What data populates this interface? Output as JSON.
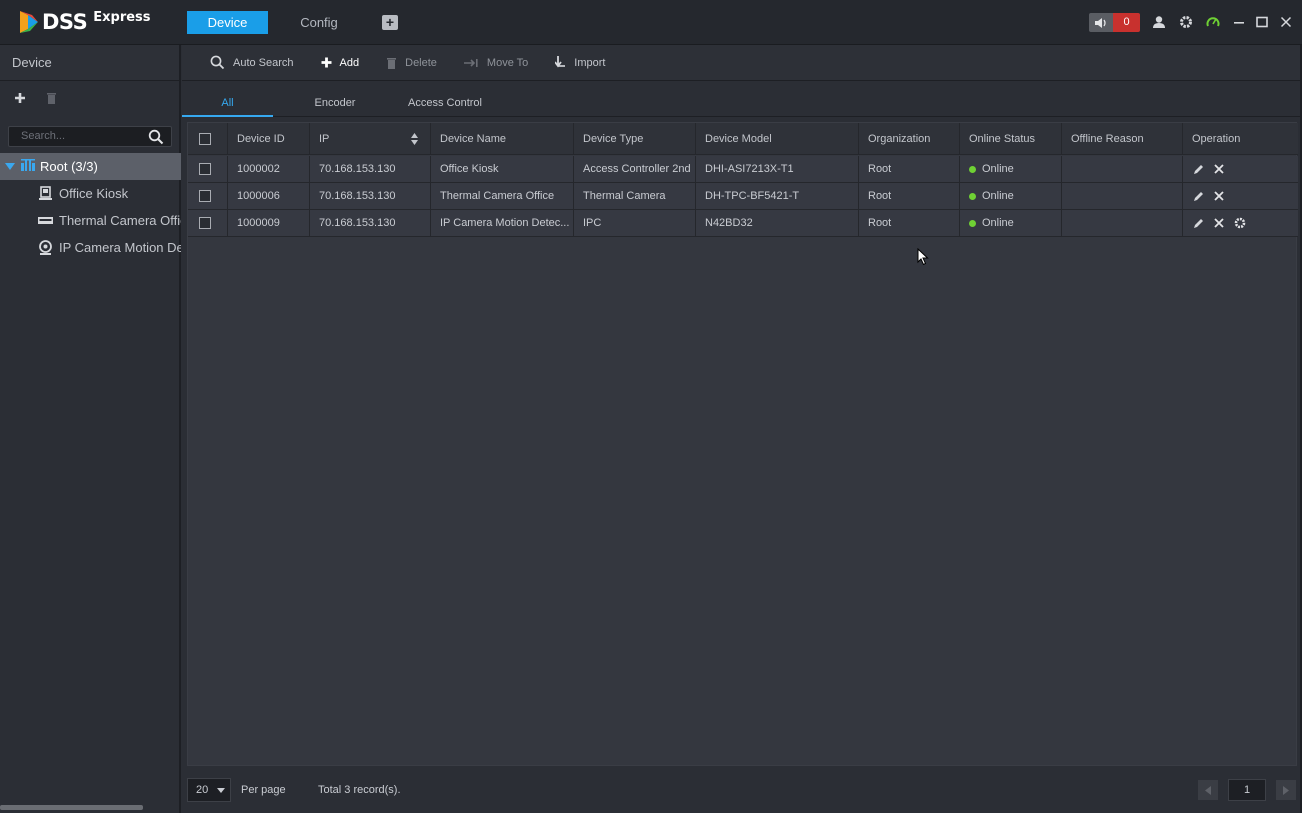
{
  "app": {
    "logo_text": "DSS",
    "logo_sub": "Express",
    "tabs": [
      {
        "label": "Device",
        "active": true
      },
      {
        "label": "Config",
        "active": false
      }
    ],
    "alarm_count": "0",
    "colors": {
      "accent": "#1a9ee8",
      "alarm": "#c8312e",
      "online": "#6fd134",
      "selected_tree": "#5c6069"
    }
  },
  "left_panel": {
    "title": "Device",
    "search_placeholder": "Search...",
    "tree_root": "Root (3/3)",
    "tree_items": [
      {
        "label": "Office Kiosk",
        "icon": "kiosk-icon"
      },
      {
        "label": "Thermal Camera Office",
        "icon": "thermal-camera-icon"
      },
      {
        "label": "IP Camera Motion Detection",
        "icon": "ip-camera-icon"
      }
    ]
  },
  "toolbar": {
    "auto_search": "Auto Search",
    "add": "Add",
    "delete": "Delete",
    "move_to": "Move To",
    "import": "Import"
  },
  "subtabs": [
    "All",
    "Encoder",
    "Access Control"
  ],
  "table": {
    "columns": [
      "Device ID",
      "IP",
      "Device Name",
      "Device Type",
      "Device Model",
      "Organization",
      "Online Status",
      "Offline Reason",
      "Operation"
    ],
    "rows": [
      {
        "device_id": "1000002",
        "ip": "70.168.153.130",
        "device_name": "Office Kiosk",
        "device_type": "Access Controller 2nd",
        "device_model": "DHI-ASI7213X-T1",
        "organization": "Root",
        "online_status": "Online",
        "offline_reason": "",
        "has_config": false
      },
      {
        "device_id": "1000006",
        "ip": "70.168.153.130",
        "device_name": "Thermal Camera Office",
        "device_type": "Thermal Camera",
        "device_model": "DH-TPC-BF5421-T",
        "organization": "Root",
        "online_status": "Online",
        "offline_reason": "",
        "has_config": false
      },
      {
        "device_id": "1000009",
        "ip": "70.168.153.130",
        "device_name": "IP Camera Motion Detec...",
        "device_type": "IPC",
        "device_model": "N42BD32",
        "organization": "Root",
        "online_status": "Online",
        "offline_reason": "",
        "has_config": true
      }
    ]
  },
  "footer": {
    "per_page_value": "20",
    "per_page_label": "Per page",
    "total": "Total 3 record(s).",
    "page": "1"
  }
}
